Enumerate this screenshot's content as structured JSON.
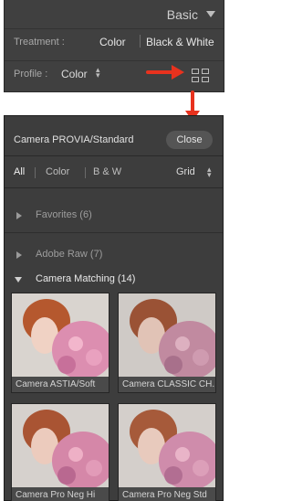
{
  "basic": {
    "title": "Basic",
    "treatment_label": "Treatment :",
    "treatment_color": "Color",
    "treatment_bw": "Black & White",
    "profile_label": "Profile :",
    "profile_value": "Color",
    "profile_stepper_icon": "up-down-arrows-icon",
    "browse_icon": "grid-icon"
  },
  "annotation": {
    "arrow_color": "#e8321e"
  },
  "browser": {
    "title": "Camera PROVIA/Standard",
    "close_label": "Close",
    "filters": {
      "all": "All",
      "color": "Color",
      "bw": "B & W"
    },
    "view_mode": "Grid",
    "groups": [
      {
        "label": "Favorites (6)",
        "expanded": false
      },
      {
        "label": "Adobe Raw (7)",
        "expanded": false
      },
      {
        "label": "Camera Matching (14)",
        "expanded": true
      }
    ],
    "thumbnails": [
      {
        "label": "Camera ASTIA/Soft"
      },
      {
        "label": "Camera CLASSIC CH..."
      },
      {
        "label": "Camera Pro Neg Hi"
      },
      {
        "label": "Camera Pro Neg Std"
      }
    ]
  }
}
